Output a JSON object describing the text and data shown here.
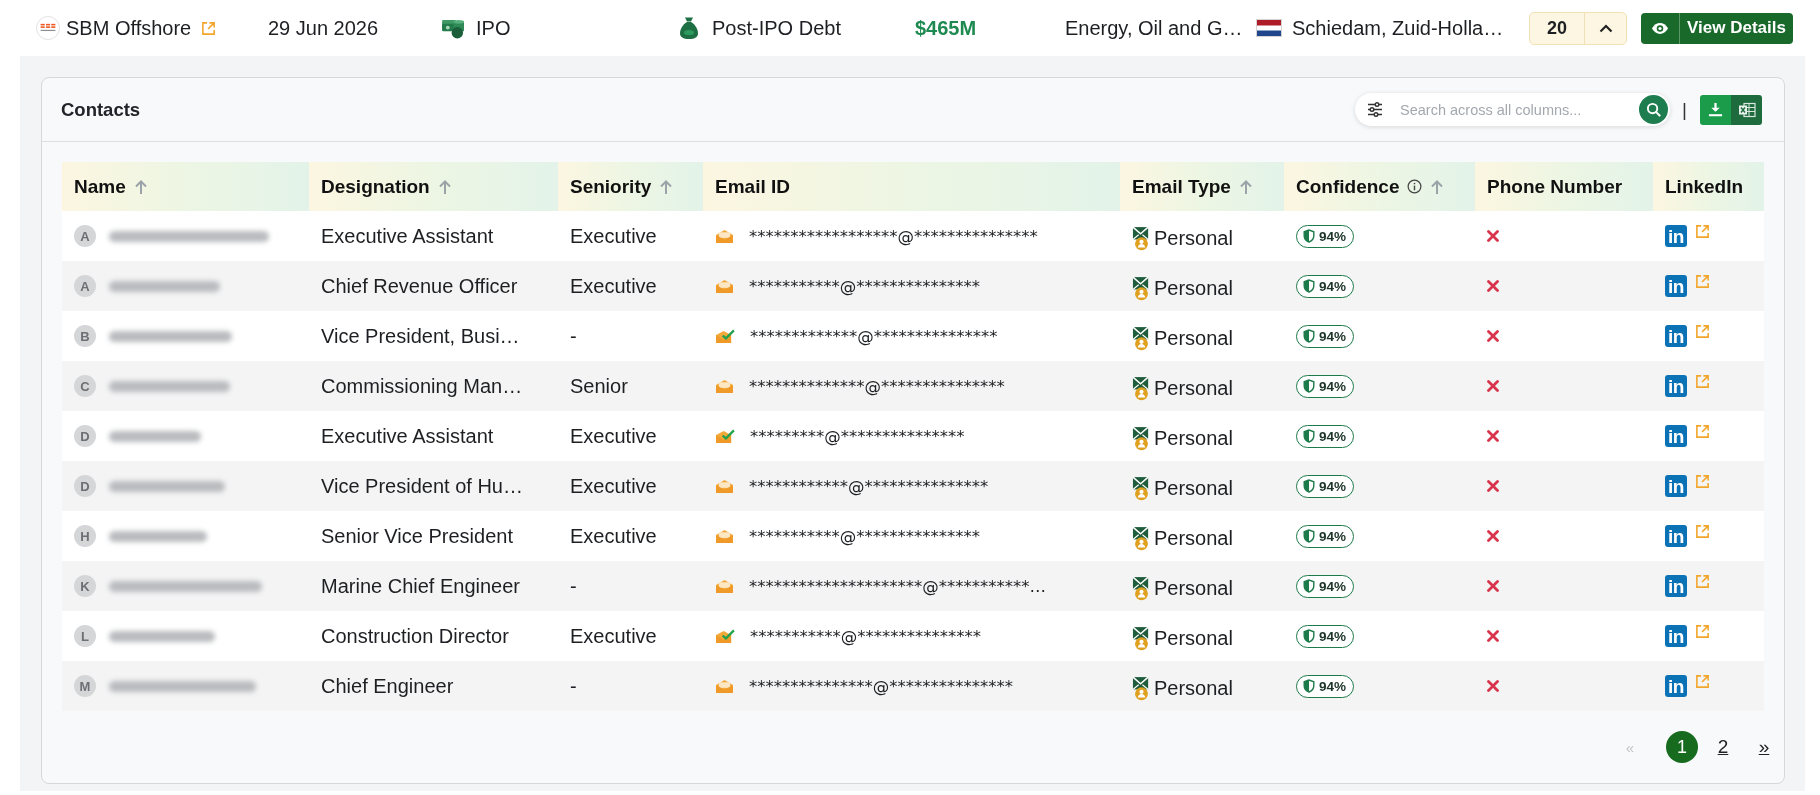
{
  "top_bar": {
    "company": "SBM Offshore",
    "date": "29 Jun 2026",
    "funding_round": "IPO",
    "funding_type": "Post-IPO Debt",
    "amount": "$465M",
    "industry": "Energy, Oil and G…",
    "location": "Schiedam, Zuid-Holla…",
    "count": "20",
    "expanded": true,
    "view_button": "View Details"
  },
  "contacts": {
    "title": "Contacts",
    "search": {
      "placeholder": "Search across all columns..."
    },
    "separator": "|",
    "columns": [
      {
        "label": "Name",
        "sortable": true,
        "info": false
      },
      {
        "label": "Designation",
        "sortable": true,
        "info": false
      },
      {
        "label": "Seniority",
        "sortable": true,
        "info": false
      },
      {
        "label": "Email ID",
        "sortable": false,
        "info": false
      },
      {
        "label": "Email Type",
        "sortable": true,
        "info": false
      },
      {
        "label": "Confidence",
        "sortable": true,
        "info": true
      },
      {
        "label": "Phone Number",
        "sortable": false,
        "info": false
      },
      {
        "label": "LinkedIn",
        "sortable": false,
        "info": false
      }
    ],
    "rows": [
      {
        "initial": "A",
        "designation": "Executive Assistant",
        "seniority": "Executive",
        "email": "******************@***************",
        "email_verified": false,
        "email_type": "Personal",
        "confidence": "94%",
        "has_phone": false,
        "linkedin": "in"
      },
      {
        "initial": "A",
        "designation": "Chief Revenue Officer",
        "seniority": "Executive",
        "email": "***********@***************",
        "email_verified": false,
        "email_type": "Personal",
        "confidence": "94%",
        "has_phone": false,
        "linkedin": "in"
      },
      {
        "initial": "B",
        "designation": "Vice President, Busi…",
        "seniority": "-",
        "email": "*************@***************",
        "email_verified": true,
        "email_type": "Personal",
        "confidence": "94%",
        "has_phone": false,
        "linkedin": "in"
      },
      {
        "initial": "C",
        "designation": "Commissioning Man…",
        "seniority": "Senior",
        "email": "**************@***************",
        "email_verified": false,
        "email_type": "Personal",
        "confidence": "94%",
        "has_phone": false,
        "linkedin": "in"
      },
      {
        "initial": "D",
        "designation": "Executive Assistant",
        "seniority": "Executive",
        "email": "*********@***************",
        "email_verified": true,
        "email_type": "Personal",
        "confidence": "94%",
        "has_phone": false,
        "linkedin": "in"
      },
      {
        "initial": "D",
        "designation": "Vice President of Hu…",
        "seniority": "Executive",
        "email": "************@***************",
        "email_verified": false,
        "email_type": "Personal",
        "confidence": "94%",
        "has_phone": false,
        "linkedin": "in"
      },
      {
        "initial": "H",
        "designation": "Senior Vice President",
        "seniority": "Executive",
        "email": "***********@***************",
        "email_verified": false,
        "email_type": "Personal",
        "confidence": "94%",
        "has_phone": false,
        "linkedin": "in"
      },
      {
        "initial": "K",
        "designation": "Marine Chief Engineer",
        "seniority": "-",
        "email": "*********************@***********…",
        "email_verified": false,
        "email_type": "Personal",
        "confidence": "94%",
        "has_phone": false,
        "linkedin": "in"
      },
      {
        "initial": "L",
        "designation": "Construction Director",
        "seniority": "Executive",
        "email": "***********@***************",
        "email_verified": true,
        "email_type": "Personal",
        "confidence": "94%",
        "has_phone": false,
        "linkedin": "in"
      },
      {
        "initial": "M",
        "designation": "Chief Engineer",
        "seniority": "-",
        "email": "***************@***************",
        "email_verified": false,
        "email_type": "Personal",
        "confidence": "94%",
        "has_phone": false,
        "linkedin": "in"
      }
    ],
    "pagination": {
      "prev": {
        "label": "«",
        "disabled": true
      },
      "pages": [
        {
          "label": "1",
          "selected": true
        },
        {
          "label": "2",
          "selected": false
        }
      ],
      "next": {
        "label": "»",
        "disabled": false
      }
    }
  }
}
